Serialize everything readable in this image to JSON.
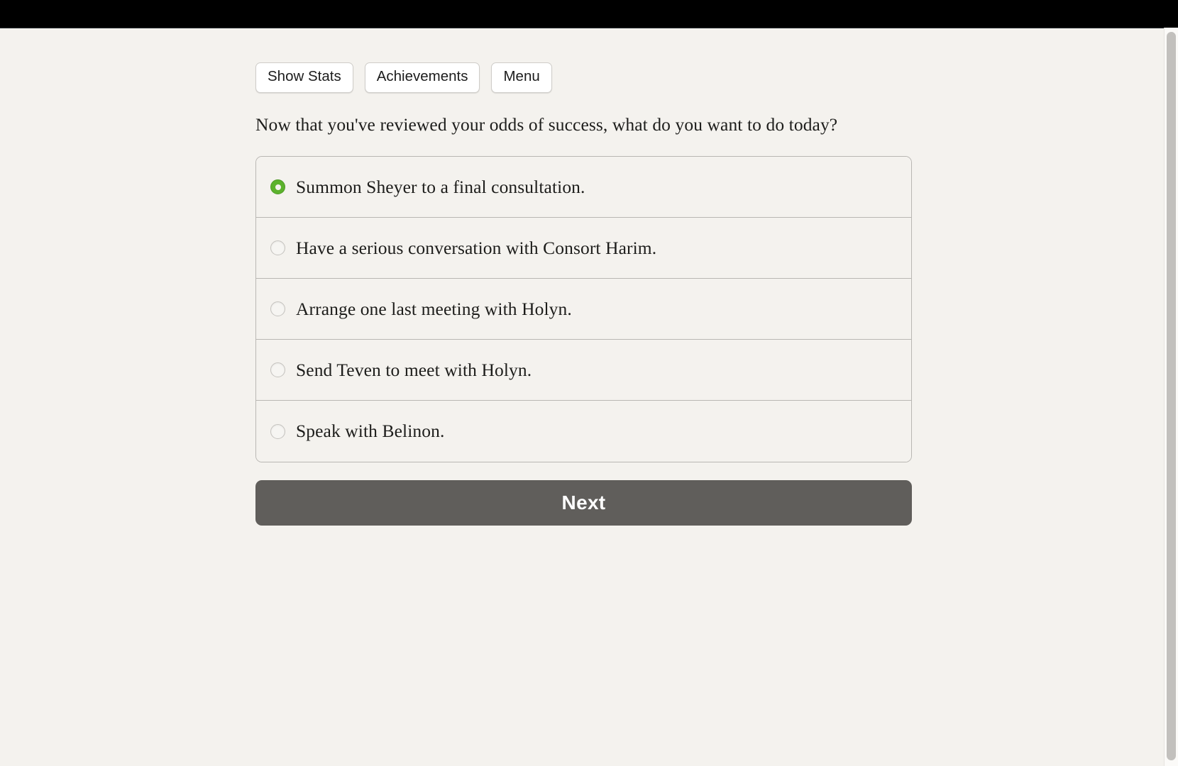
{
  "window": {
    "chrome_bar_color": "#000000",
    "page_background": "#f4f2ee"
  },
  "toolbar": {
    "buttons": [
      {
        "label": "Show Stats",
        "name": "show-stats-button"
      },
      {
        "label": "Achievements",
        "name": "achievements-button"
      },
      {
        "label": "Menu",
        "name": "menu-button"
      }
    ]
  },
  "prompt": {
    "text": "Now that you've reviewed your odds of success, what do you want to do today?"
  },
  "choices": {
    "selected_index": 0,
    "selected_color": "#5cb22d",
    "options": [
      {
        "label": "Summon Sheyer to a final consultation.",
        "selected": true
      },
      {
        "label": "Have a serious conversation with Consort Harim.",
        "selected": false
      },
      {
        "label": "Arrange one last meeting with Holyn.",
        "selected": false
      },
      {
        "label": "Send Teven to meet with Holyn.",
        "selected": false
      },
      {
        "label": "Speak with Belinon.",
        "selected": false
      }
    ]
  },
  "actions": {
    "next_label": "Next",
    "next_color": "#605e5b"
  },
  "scrollbar": {
    "thumb_color": "#c2c0bd",
    "track_color": "#fbfaf8"
  }
}
